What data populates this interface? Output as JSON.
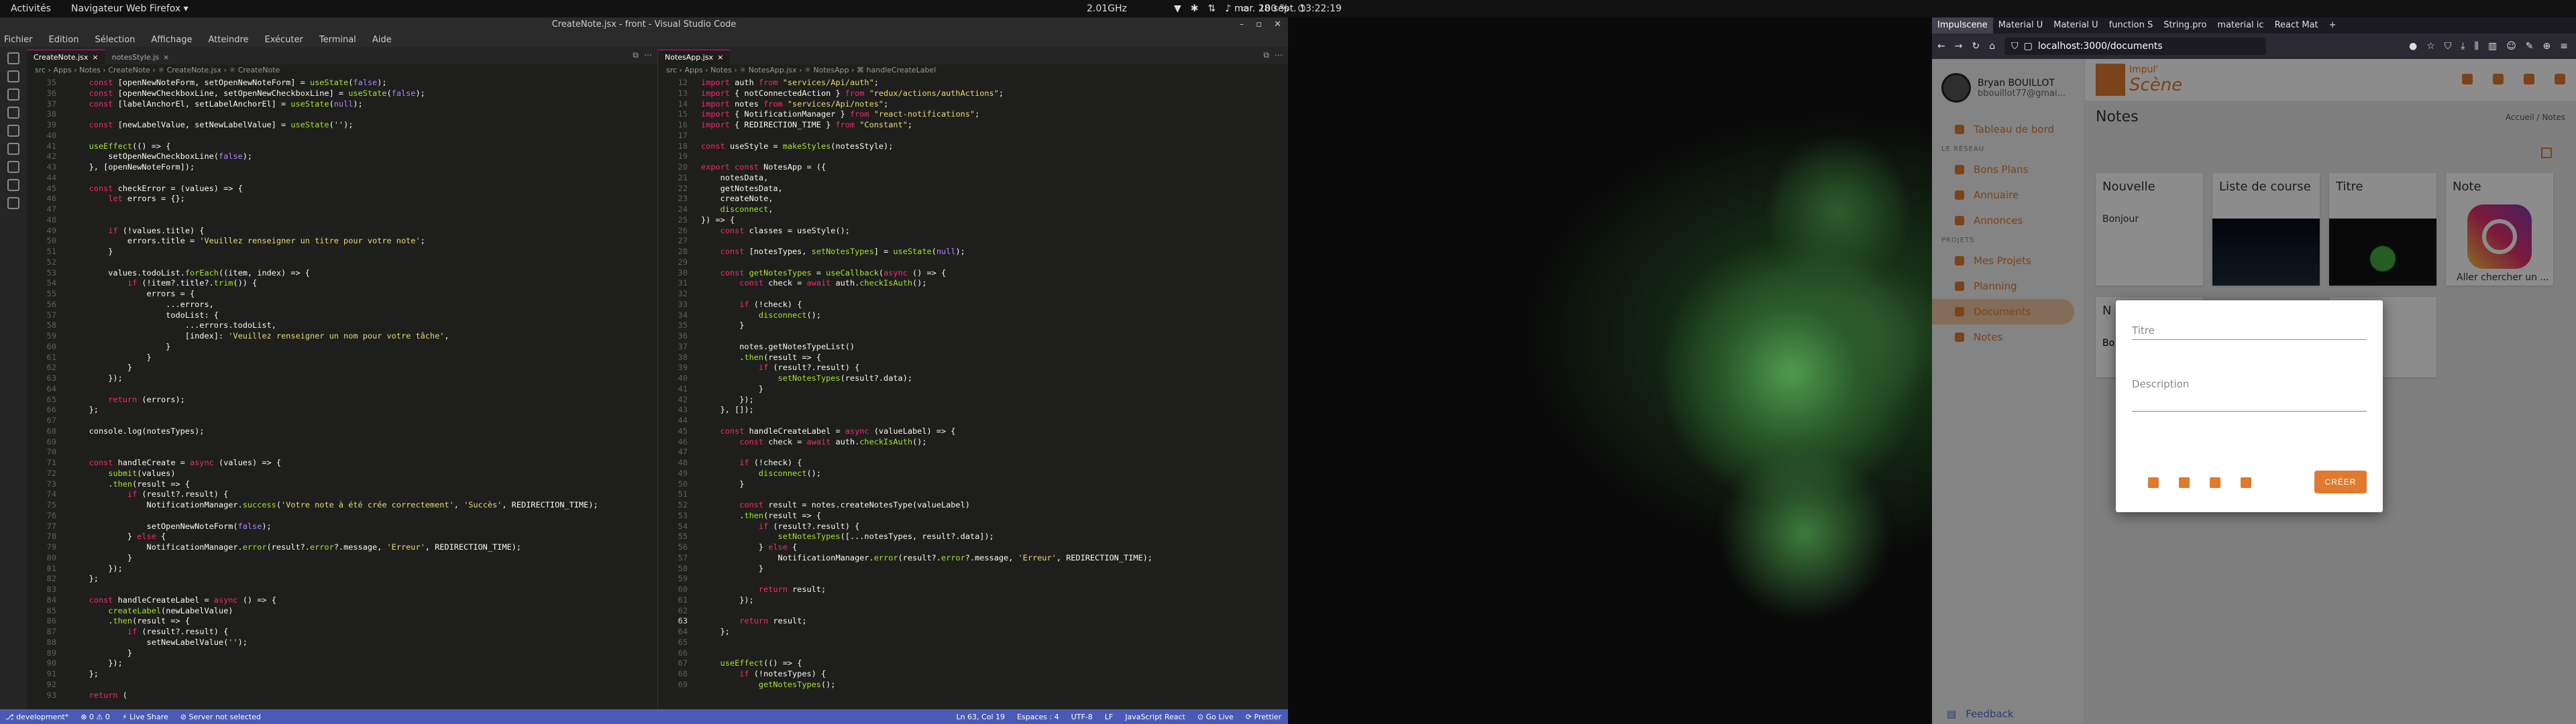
{
  "topbar": {
    "activities": "Activités",
    "app": "Navigateur Web Firefox ▾",
    "clock": "mar. 28 sept.  13:22:19",
    "cpu": "2.01GHz",
    "battery": "100 %"
  },
  "vscode": {
    "title": "CreateNote.jsx - front - Visual Studio Code",
    "menu": [
      "Fichier",
      "Edition",
      "Sélection",
      "Affichage",
      "Atteindre",
      "Exécuter",
      "Terminal",
      "Aide"
    ],
    "left_tabs": [
      {
        "label": "CreateNote.jsx",
        "active": true
      },
      {
        "label": "notesStyle.js",
        "active": false
      }
    ],
    "left_crumb": "src › Apps › Notes › CreateNote › ⚛ CreateNote.jsx › ⚛ CreateNote",
    "right_tabs": [
      {
        "label": "NotesApp.jsx",
        "active": true
      }
    ],
    "right_crumb": "src › Apps › Notes › ⚛ NotesApp.jsx › ⚛ NotesApp › ⌘ handleCreateLabel",
    "left_code": [
      [
        35,
        "    const [openNewNoteForm, setOpenNewNoteForm] = useState(false);"
      ],
      [
        36,
        "    const [openNewCheckboxLine, setOpenNewCheckboxLine] = useState(false);"
      ],
      [
        37,
        "    const [labelAnchorEl, setLabelAnchorEl] = useState(null);"
      ],
      [
        38,
        ""
      ],
      [
        39,
        "    const [newLabelValue, setNewLabelValue] = useState('');"
      ],
      [
        40,
        ""
      ],
      [
        41,
        "    useEffect(() => {"
      ],
      [
        42,
        "        setOpenNewCheckboxLine(false);"
      ],
      [
        43,
        "    }, [openNewNoteForm]);"
      ],
      [
        44,
        ""
      ],
      [
        45,
        "    const checkError = (values) => {"
      ],
      [
        46,
        "        let errors = {};"
      ],
      [
        47,
        ""
      ],
      [
        48,
        ""
      ],
      [
        49,
        "        if (!values.title) {"
      ],
      [
        50,
        "            errors.title = 'Veuillez renseigner un titre pour votre note';"
      ],
      [
        51,
        "        }"
      ],
      [
        52,
        ""
      ],
      [
        53,
        "        values.todoList.forEach((item, index) => {"
      ],
      [
        54,
        "            if (!item?.title?.trim()) {"
      ],
      [
        55,
        "                errors = {"
      ],
      [
        56,
        "                    ...errors,"
      ],
      [
        57,
        "                    todoList: {"
      ],
      [
        58,
        "                        ...errors.todoList,"
      ],
      [
        59,
        "                        [index]: 'Veuillez renseigner un nom pour votre tâche',"
      ],
      [
        60,
        "                    }"
      ],
      [
        61,
        "                }"
      ],
      [
        62,
        "            }"
      ],
      [
        63,
        "        });"
      ],
      [
        64,
        ""
      ],
      [
        65,
        "        return (errors);"
      ],
      [
        66,
        "    };"
      ],
      [
        67,
        ""
      ],
      [
        68,
        "    console.log(notesTypes);"
      ],
      [
        69,
        ""
      ],
      [
        70,
        ""
      ],
      [
        71,
        "    const handleCreate = async (values) => {"
      ],
      [
        72,
        "        submit(values)"
      ],
      [
        73,
        "        .then(result => {"
      ],
      [
        74,
        "            if (result?.result) {"
      ],
      [
        75,
        "                NotificationManager.success('Votre note à été crée correctement', 'Succès', REDIRECTION_TIME);"
      ],
      [
        76,
        ""
      ],
      [
        77,
        "                setOpenNewNoteForm(false);"
      ],
      [
        78,
        "            } else {"
      ],
      [
        79,
        "                NotificationManager.error(result?.error?.message, 'Erreur', REDIRECTION_TIME);"
      ],
      [
        80,
        "            }"
      ],
      [
        81,
        "        });"
      ],
      [
        82,
        "    };"
      ],
      [
        83,
        ""
      ],
      [
        84,
        "    const handleCreateLabel = async () => {"
      ],
      [
        85,
        "        createLabel(newLabelValue)"
      ],
      [
        86,
        "        .then(result => {"
      ],
      [
        87,
        "            if (result?.result) {"
      ],
      [
        88,
        "                setNewLabelValue('');"
      ],
      [
        89,
        "            }"
      ],
      [
        90,
        "        });"
      ],
      [
        91,
        "    };"
      ],
      [
        92,
        ""
      ],
      [
        93,
        "    return ("
      ]
    ],
    "right_code": [
      [
        12,
        "import auth from \"services/Api/auth\";"
      ],
      [
        13,
        "import { notConnectedAction } from \"redux/actions/authActions\";"
      ],
      [
        14,
        "import notes from \"services/Api/notes\";"
      ],
      [
        15,
        "import { NotificationManager } from \"react-notifications\";"
      ],
      [
        16,
        "import { REDIRECTION_TIME } from \"Constant\";"
      ],
      [
        17,
        ""
      ],
      [
        18,
        "const useStyle = makeStyles(notesStyle);"
      ],
      [
        19,
        ""
      ],
      [
        20,
        "export const NotesApp = ({"
      ],
      [
        21,
        "    notesData,"
      ],
      [
        22,
        "    getNotesData,"
      ],
      [
        23,
        "    createNote,"
      ],
      [
        24,
        "    disconnect,"
      ],
      [
        25,
        "}) => {"
      ],
      [
        26,
        "    const classes = useStyle();"
      ],
      [
        27,
        ""
      ],
      [
        28,
        "    const [notesTypes, setNotesTypes] = useState(null);"
      ],
      [
        29,
        ""
      ],
      [
        30,
        "    const getNotesTypes = useCallback(async () => {"
      ],
      [
        31,
        "        const check = await auth.checkIsAuth();"
      ],
      [
        32,
        ""
      ],
      [
        33,
        "        if (!check) {"
      ],
      [
        34,
        "            disconnect();"
      ],
      [
        35,
        "        }"
      ],
      [
        36,
        ""
      ],
      [
        37,
        "        notes.getNotesTypeList()"
      ],
      [
        38,
        "        .then(result => {"
      ],
      [
        39,
        "            if (result?.result) {"
      ],
      [
        40,
        "                setNotesTypes(result?.data);"
      ],
      [
        41,
        "            }"
      ],
      [
        42,
        "        });"
      ],
      [
        43,
        "    }, []);"
      ],
      [
        44,
        ""
      ],
      [
        45,
        "    const handleCreateLabel = async (valueLabel) => {"
      ],
      [
        46,
        "        const check = await auth.checkIsAuth();"
      ],
      [
        47,
        ""
      ],
      [
        48,
        "        if (!check) {"
      ],
      [
        49,
        "            disconnect();"
      ],
      [
        50,
        "        }"
      ],
      [
        51,
        ""
      ],
      [
        52,
        "        const result = notes.createNotesType(valueLabel)"
      ],
      [
        53,
        "        .then(result => {"
      ],
      [
        54,
        "            if (result?.result) {"
      ],
      [
        55,
        "                setNotesTypes([...notesTypes, result?.data]);"
      ],
      [
        56,
        "            } else {"
      ],
      [
        57,
        "                NotificationManager.error(result?.error?.message, 'Erreur', REDIRECTION_TIME);"
      ],
      [
        58,
        "            }"
      ],
      [
        59,
        ""
      ],
      [
        60,
        "            return result;"
      ],
      [
        61,
        "        });"
      ],
      [
        62,
        ""
      ],
      [
        63,
        "        return result;"
      ],
      [
        64,
        "    };"
      ],
      [
        65,
        ""
      ],
      [
        66,
        ""
      ],
      [
        67,
        "    useEffect(() => {"
      ],
      [
        68,
        "        if (!notesTypes) {"
      ],
      [
        69,
        "            getNotesTypes();"
      ]
    ],
    "right_cursor_line": 63,
    "status_left": [
      "⎇ development*",
      "⊗ 0 ⚠ 0",
      "⚡ Live Share",
      "⊘ Server not selected"
    ],
    "status_right": [
      "Ln 63, Col 19",
      "Espaces : 4",
      "UTF-8",
      "LF",
      "JavaScript React",
      "⊙ Go Live",
      "⟳ Prettier"
    ]
  },
  "firefox": {
    "tabs": [
      {
        "label": "Impulscene",
        "active": true
      },
      {
        "label": "Material U",
        "active": false
      },
      {
        "label": "Material U",
        "active": false
      },
      {
        "label": "function S",
        "active": false
      },
      {
        "label": "String.pro",
        "active": false
      },
      {
        "label": "material ic",
        "active": false
      },
      {
        "label": "React Mat",
        "active": false
      }
    ],
    "new_tab": "+",
    "url": "localhost:3000/documents",
    "app": {
      "user_name": "Bryan BOUILLOT",
      "user_email": "bbouillot77@gmai...",
      "nav": [
        {
          "label": "Tableau de bord",
          "section": ""
        },
        {
          "label": "Bons Plans",
          "section": "LE RÉSEAU"
        },
        {
          "label": "Annuaire",
          "section": ""
        },
        {
          "label": "Annonces",
          "section": ""
        },
        {
          "label": "Mes Projets",
          "section": "PROJETS"
        },
        {
          "label": "Planning",
          "section": ""
        },
        {
          "label": "Documents",
          "section": "",
          "active": true
        },
        {
          "label": "Notes",
          "section": ""
        }
      ],
      "sections": {
        "reseau": "LE RÉSEAU",
        "projets": "PROJETS"
      },
      "feedback": "Feedback",
      "logo_small": "Impul'",
      "logo_big": "Scène",
      "page_title": "Notes",
      "breadcrumb": "Accueil  /  Notes",
      "cards": [
        {
          "title": "Nouvelle",
          "text": "Bonjour"
        },
        {
          "title": "Liste de course",
          "text": ""
        },
        {
          "title": "Titre",
          "text": ""
        },
        {
          "title": "Note",
          "text": "Aller chercher un ..."
        }
      ],
      "cards_row2": [
        {
          "title": "N",
          "text": "Bo"
        },
        {
          "title": "le Note",
          "text": ""
        }
      ],
      "modal": {
        "title_placeholder": "Titre",
        "description_placeholder": "Description",
        "create": "CRÉER"
      }
    }
  }
}
